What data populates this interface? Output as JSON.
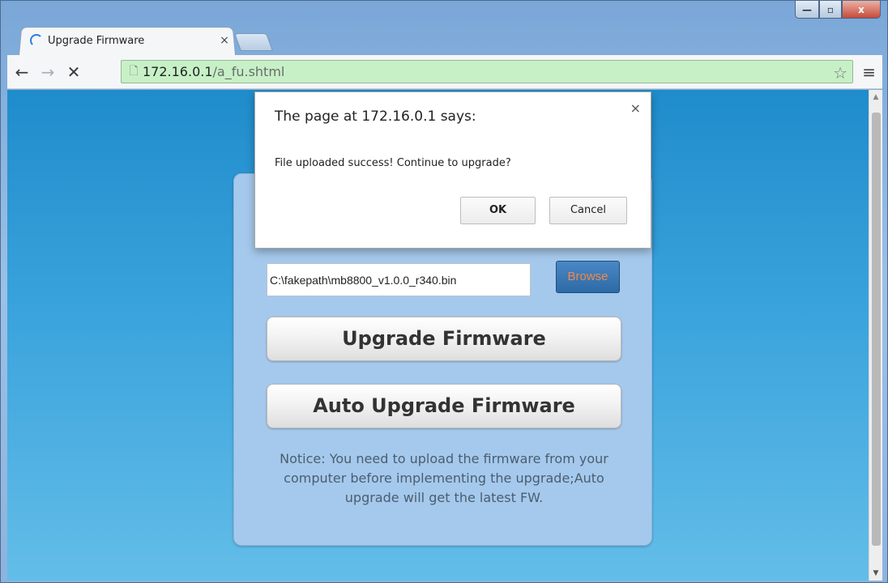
{
  "window": {
    "controls": {
      "minimize": "—",
      "maximize": "▫",
      "close": "x"
    }
  },
  "tab": {
    "title": "Upgrade Firmware",
    "close": "×"
  },
  "toolbar": {
    "back_icon": "←",
    "forward_icon": "→",
    "stop_icon": "✕",
    "url_host": "172.16.0.1",
    "url_path": "/a_fu.shtml",
    "page_icon": "🗋",
    "star_icon": "☆",
    "menu_icon": "≡"
  },
  "dialog": {
    "title": "The page at 172.16.0.1 says:",
    "message": "File uploaded success! Continue to upgrade?",
    "ok_label": "OK",
    "cancel_label": "Cancel",
    "close_icon": "×"
  },
  "page": {
    "file_value": "C:\\fakepath\\mb8800_v1.0.0_r340.bin",
    "browse_label": "Browse",
    "upgrade_label": "Upgrade Firmware",
    "auto_upgrade_label": "Auto Upgrade Firmware",
    "notice": "Notice: You need to upload the firmware from your computer before implementing the upgrade;Auto upgrade will get the latest FW."
  },
  "scrollbar": {
    "up": "▲",
    "down": "▼"
  },
  "colors": {
    "omnibox_bg": "#c7f0c7",
    "page_bg_top": "#1f8ccb",
    "page_bg_bottom": "#63bde8",
    "card_bg": "#a5c9ec",
    "browse_text": "#f08a4b"
  }
}
